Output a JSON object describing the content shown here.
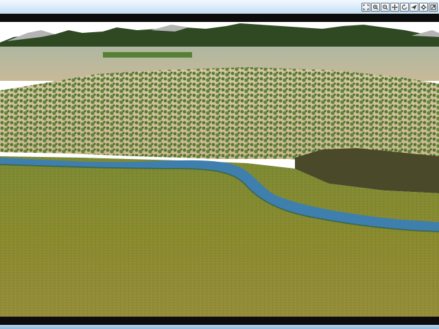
{
  "window": {
    "toolbar_buttons": [
      {
        "icon": "zoom-extent-icon"
      },
      {
        "icon": "zoom-in-icon"
      },
      {
        "icon": "zoom-out-icon"
      },
      {
        "icon": "pan-icon"
      },
      {
        "icon": "rotate-icon"
      },
      {
        "icon": "fly-icon"
      },
      {
        "icon": "settings-icon"
      },
      {
        "icon": "fullscreen-icon"
      }
    ]
  },
  "scene": {
    "type": "3d-terrain-view",
    "features": [
      "distant-mountains",
      "wooded-hills",
      "river",
      "grassland-plain",
      "wetland"
    ],
    "colors": {
      "sky": "#ffffff",
      "grassland": "#8a8a2e",
      "river": "#3f7fae",
      "forest": "#3d6b22",
      "bare_ground": "#d9c8a3",
      "mountains": "#9a9a9a"
    }
  }
}
